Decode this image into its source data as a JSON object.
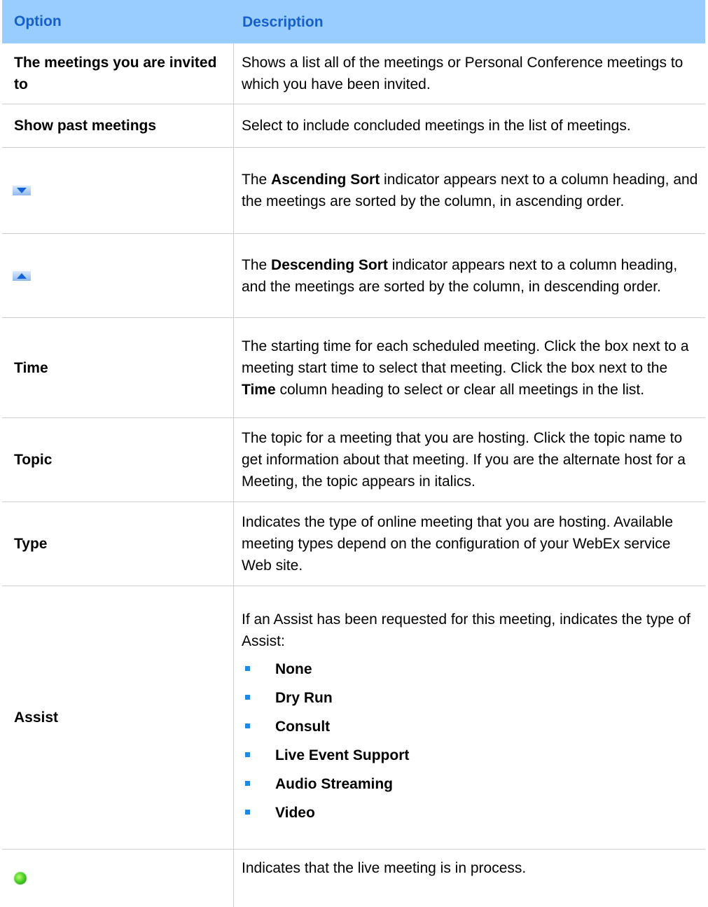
{
  "table": {
    "headers": {
      "option": "Option",
      "description": "Description"
    },
    "rows": [
      {
        "option": "The meetings you are invited to",
        "description": "Shows a list all of the meetings or Personal Conference meetings to which you have been invited."
      },
      {
        "option": "Show past meetings",
        "description": "Select to include concluded meetings in the list of meetings."
      },
      {
        "option_icon": "ascending-sort-icon",
        "desc_pre": "The ",
        "desc_bold": "Ascending Sort",
        "desc_post": " indicator appears next to a column heading, and the meetings are sorted by the column, in ascending order."
      },
      {
        "option_icon": "descending-sort-icon",
        "desc_pre": "The ",
        "desc_bold": "Descending Sort",
        "desc_post": " indicator appears next to a column heading, and the meetings are sorted by the column, in descending order."
      },
      {
        "option": "Time",
        "desc_pre": "The starting time for each scheduled meeting. Click the box next to a meeting start time to select that meeting. Click the box next to the ",
        "desc_bold": "Time",
        "desc_post": " column heading to select or clear all meetings in the list."
      },
      {
        "option": "Topic",
        "description": "The topic for a meeting that you are hosting. Click the topic name to get information about that meeting. If you are the alternate host for a Meeting, the topic appears in italics."
      },
      {
        "option": "Type",
        "description": "Indicates the type of online meeting that you are hosting. Available meeting types depend on the configuration of your WebEx service Web site."
      },
      {
        "option": "Assist",
        "description": "If an Assist has been requested for this meeting, indicates the type of Assist:",
        "items": [
          "None",
          "Dry Run",
          "Consult",
          "Live Event Support",
          "Audio Streaming",
          "Video"
        ]
      },
      {
        "option_icon": "live-meeting-status-icon",
        "description": "Indicates that the live meeting is in process."
      }
    ]
  },
  "colors": {
    "header_bg": "#99ccff",
    "header_text": "#1560cc",
    "bullet": "#1e88e5"
  }
}
